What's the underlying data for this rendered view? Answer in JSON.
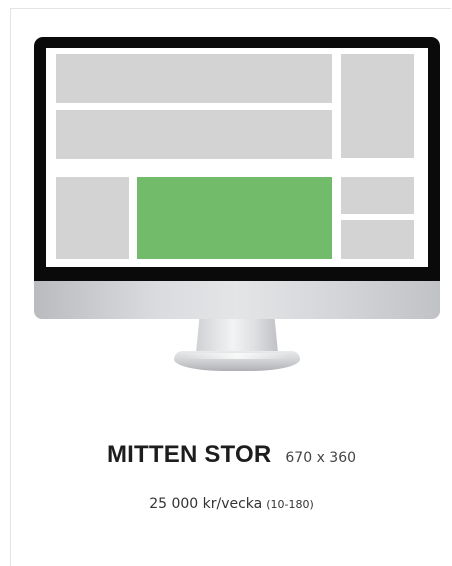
{
  "product": {
    "title": "MITTEN STOR",
    "dimensions": "670 x 360",
    "price": "25 000 kr/vecka",
    "week_range": "(10-180)",
    "highlight_color": "#72bb6b",
    "slot_color": "#d3d3d3"
  },
  "illustration": {
    "icon": "desktop-monitor-icon",
    "highlighted_slot": "middle-large"
  }
}
